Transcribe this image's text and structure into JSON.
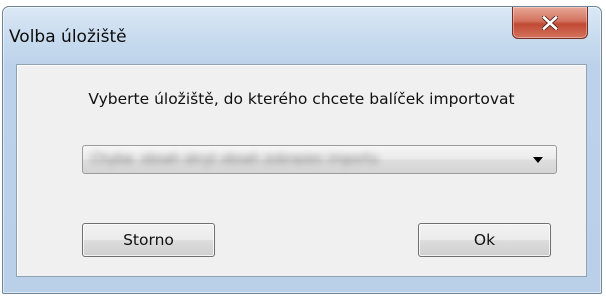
{
  "window": {
    "title": "Volba úložiště",
    "close_icon": "close-x-icon"
  },
  "dialog": {
    "prompt": "Vyberte úložiště, do kterého chcete balíček importovat",
    "repository_select": {
      "value": "Chyba: obsah skryt obsah zobrazen importu"
    },
    "buttons": {
      "cancel_label": "Storno",
      "ok_label": "Ok"
    }
  },
  "colors": {
    "title_bar": "#c9dcef",
    "close_button": "#c7503a",
    "client_background": "#f0f0f0"
  }
}
